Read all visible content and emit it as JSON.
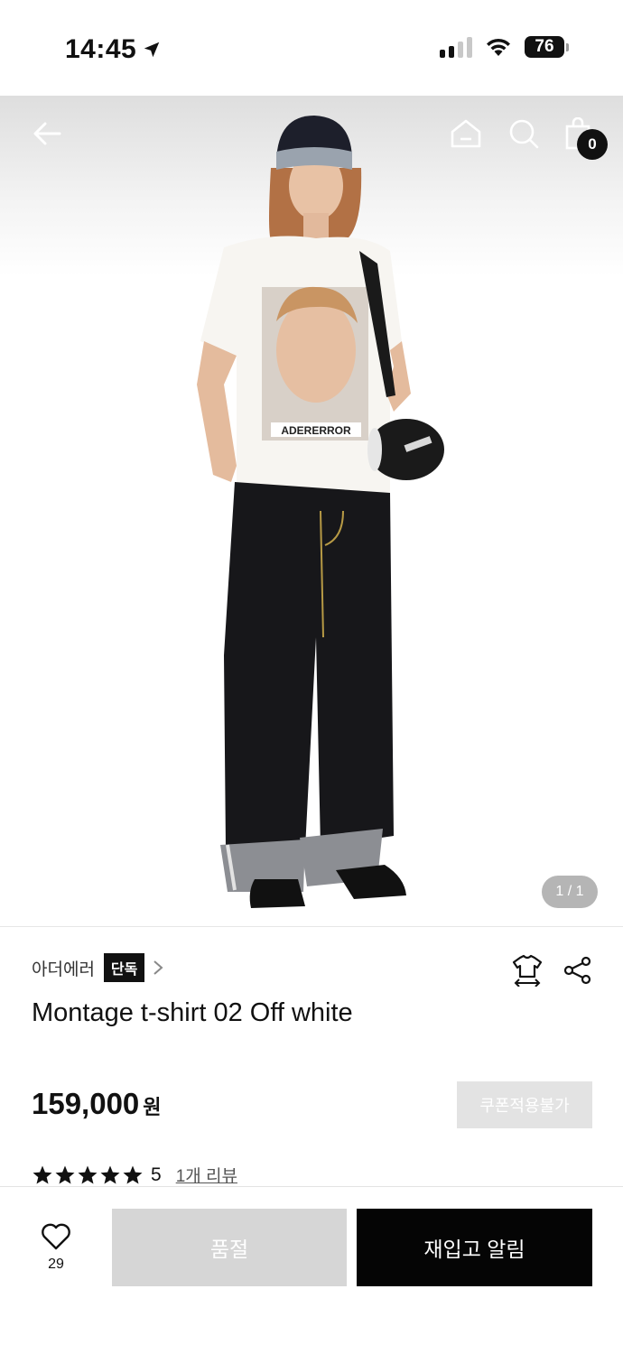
{
  "status_bar": {
    "time": "14:45",
    "battery": "76",
    "icons": [
      "location-arrow-icon",
      "cellular-signal-icon",
      "wifi-icon",
      "battery-icon"
    ]
  },
  "top_nav": {
    "icons": [
      "back-arrow-icon",
      "home-icon",
      "search-icon",
      "shopping-bag-icon"
    ],
    "cart_count": "0"
  },
  "gallery": {
    "page_indicator": "1 / 1"
  },
  "product": {
    "brand": "아더에러",
    "brand_badge": "단독",
    "title": "Montage t-shirt 02 Off white",
    "price": "159,000",
    "price_unit": "원",
    "coupon_label": "쿠폰적용불가",
    "rating_stars": 5,
    "rating_value": "5",
    "review_link": "1개 리뷰",
    "print_text": "ADERERROR"
  },
  "bottom_bar": {
    "wish_count": "29",
    "soldout_label": "품절",
    "restock_label": "재입고 알림"
  },
  "colors": {
    "primary": "#050505",
    "disabled": "#d6d6d6",
    "coupon_disabled": "#e3e3e3"
  }
}
